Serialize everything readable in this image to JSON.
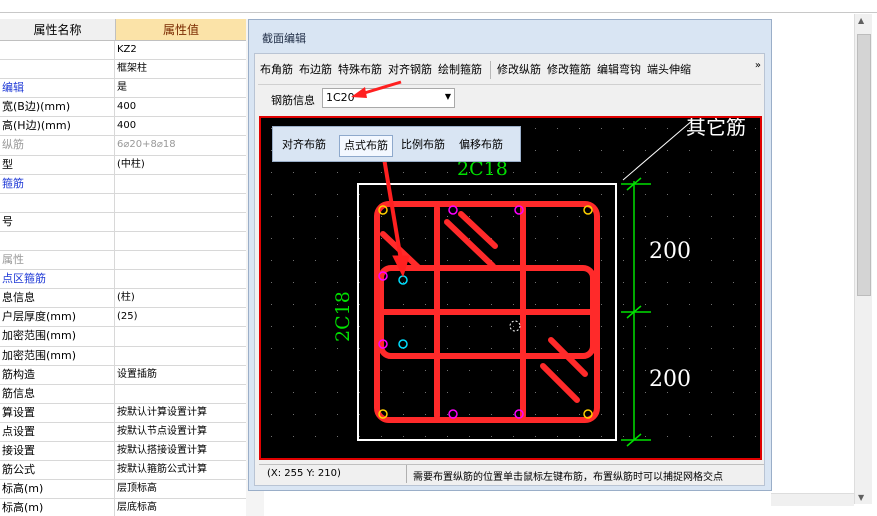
{
  "grid": {
    "header": {
      "name": "属性名称",
      "value": "属性值"
    },
    "rows": [
      {
        "name": "",
        "value": "KZ2",
        "style": ""
      },
      {
        "name": "",
        "value": "框架柱",
        "style": ""
      },
      {
        "name": "编辑",
        "value": "是",
        "style": "blue"
      },
      {
        "name": "宽(B边)(mm)",
        "value": "400",
        "style": ""
      },
      {
        "name": "高(H边)(mm)",
        "value": "400",
        "style": ""
      },
      {
        "name": "纵筋",
        "value": "6⌀20+8⌀18",
        "style": "gray"
      },
      {
        "name": "型",
        "value": "(中柱)",
        "style": ""
      },
      {
        "name": "箍筋",
        "value": "",
        "style": "blue"
      },
      {
        "name": "",
        "value": "",
        "style": ""
      },
      {
        "name": "号",
        "value": "",
        "style": ""
      },
      {
        "name": "",
        "value": "",
        "style": ""
      },
      {
        "name": "属性",
        "value": "",
        "style": "gray"
      },
      {
        "name": "点区箍筋",
        "value": "",
        "style": "blue"
      },
      {
        "name": "息信息",
        "value": "(柱)",
        "style": ""
      },
      {
        "name": "户层厚度(mm)",
        "value": "(25)",
        "style": ""
      },
      {
        "name": "加密范围(mm)",
        "value": "",
        "style": ""
      },
      {
        "name": "加密范围(mm)",
        "value": "",
        "style": ""
      },
      {
        "name": "筋构造",
        "value": "设置插筋",
        "style": ""
      },
      {
        "name": "筋信息",
        "value": "",
        "style": ""
      },
      {
        "name": "算设置",
        "value": "按默认计算设置计算",
        "style": ""
      },
      {
        "name": "点设置",
        "value": "按默认节点设置计算",
        "style": ""
      },
      {
        "name": "接设置",
        "value": "按默认搭接设置计算",
        "style": ""
      },
      {
        "name": "筋公式",
        "value": "按默认箍筋公式计算",
        "style": ""
      },
      {
        "name": "标高(m)",
        "value": "层顶标高",
        "style": ""
      },
      {
        "name": "标高(m)",
        "value": "层底标高",
        "style": ""
      }
    ]
  },
  "dialog": {
    "title": "截面编辑",
    "toolbar": [
      "布角筋",
      "布边筋",
      "特殊布筋",
      "对齐钢筋",
      "绘制箍筋",
      "修改纵筋",
      "修改箍筋",
      "编辑弯钩",
      "端头伸缩"
    ],
    "more": "»",
    "rebar_label": "钢筋信息",
    "rebar_value": "1C20",
    "layout_buttons": [
      "对齐布筋",
      "点式布筋",
      "比例布筋",
      "偏移布筋"
    ],
    "canvas": {
      "label_top": "2C18",
      "label_left": "2C18",
      "dim1": "200",
      "dim2": "200",
      "other_text": "其它筋"
    },
    "status": {
      "coord": "(X: 255 Y: 210)",
      "message": "需要布置纵筋的位置单击鼠标左键布筋，布置纵筋时可以捕捉网格交点"
    }
  },
  "colors": {
    "canvas_bg": "#000000",
    "rebar": "#ff2a2a",
    "dimension": "#00e000",
    "column_outline": "#ffffff",
    "grid_dot": "#707070",
    "header_bg": "#fbe3a8"
  }
}
